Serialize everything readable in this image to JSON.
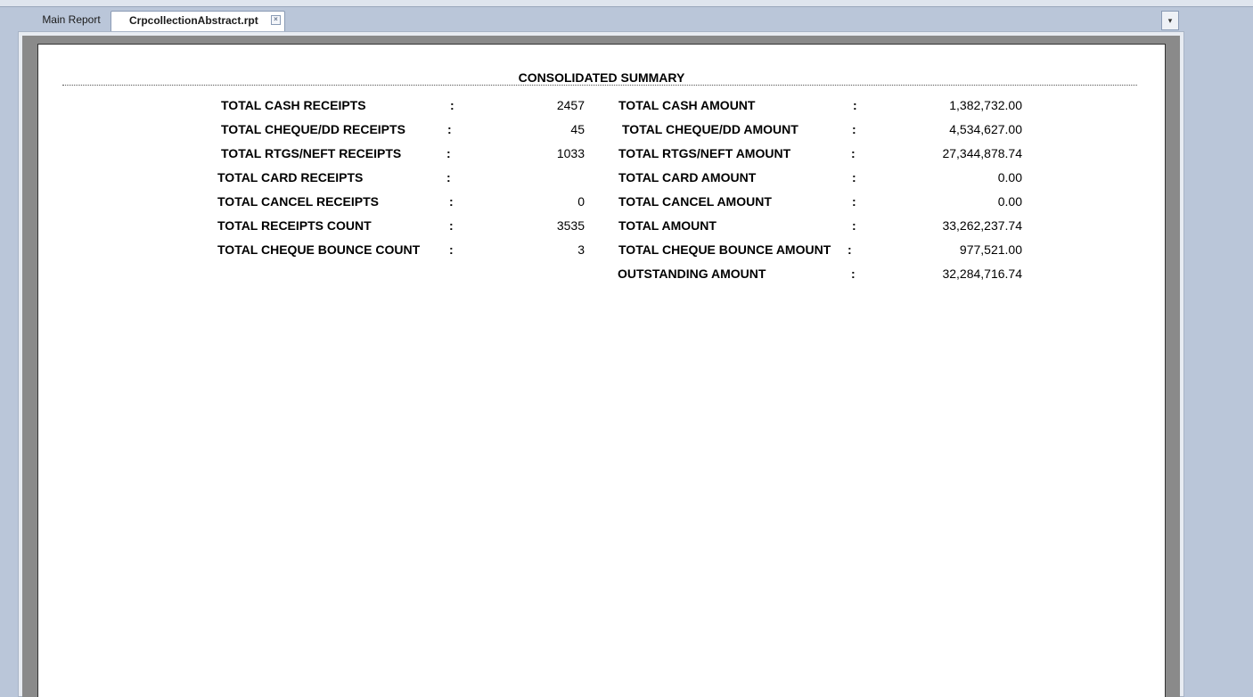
{
  "tabs": {
    "main_report": "Main Report",
    "active": "CrpcollectionAbstract.rpt",
    "close_glyph": "×"
  },
  "dropdown_glyph": "▾",
  "report": {
    "title": "CONSOLIDATED SUMMARY",
    "separator": ":",
    "left": [
      {
        "label": "TOTAL CASH RECEIPTS",
        "value": "2457"
      },
      {
        "label": "TOTAL CHEQUE/DD RECEIPTS",
        "value": "45"
      },
      {
        "label": "TOTAL RTGS/NEFT RECEIPTS",
        "value": "1033"
      },
      {
        "label": "TOTAL CARD RECEIPTS",
        "value": ""
      },
      {
        "label": "TOTAL CANCEL RECEIPTS",
        "value": "0"
      },
      {
        "label": "TOTAL RECEIPTS COUNT",
        "value": "3535"
      },
      {
        "label": "TOTAL CHEQUE BOUNCE COUNT",
        "value": "3"
      }
    ],
    "right": [
      {
        "label": "TOTAL CASH AMOUNT",
        "value": "1,382,732.00"
      },
      {
        "label": "TOTAL CHEQUE/DD AMOUNT",
        "value": "4,534,627.00"
      },
      {
        "label": "TOTAL RTGS/NEFT AMOUNT",
        "value": "27,344,878.74"
      },
      {
        "label": "TOTAL CARD AMOUNT",
        "value": "0.00"
      },
      {
        "label": "TOTAL CANCEL AMOUNT",
        "value": "0.00"
      },
      {
        "label": "TOTAL AMOUNT",
        "value": "33,262,237.74"
      },
      {
        "label": "TOTAL CHEQUE BOUNCE AMOUNT",
        "value": "977,521.00"
      },
      {
        "label": "OUTSTANDING AMOUNT",
        "value": "32,284,716.74"
      }
    ]
  }
}
